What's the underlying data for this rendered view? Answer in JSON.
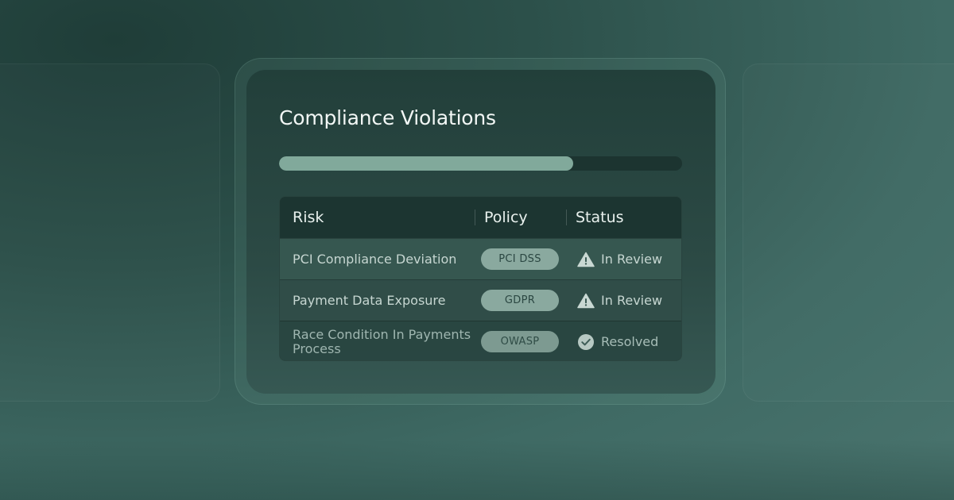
{
  "card": {
    "title": "Compliance Violations",
    "progress_percent": 73
  },
  "table": {
    "headers": {
      "risk": "Risk",
      "policy": "Policy",
      "status": "Status"
    },
    "rows": [
      {
        "risk": "PCI Compliance Deviation",
        "policy": "PCI DSS",
        "status": "In Review",
        "status_icon": "warning-icon"
      },
      {
        "risk": "Payment Data Exposure",
        "policy": "GDPR",
        "status": "In Review",
        "status_icon": "warning-icon"
      },
      {
        "risk": "Race Condition In Payments Process",
        "policy": "OWASP",
        "status": "Resolved",
        "status_icon": "check-circle-icon"
      }
    ]
  },
  "colors": {
    "progress_fill": "#81a99b",
    "badge": "#8aa99f",
    "card_background": "#2c4a45"
  }
}
